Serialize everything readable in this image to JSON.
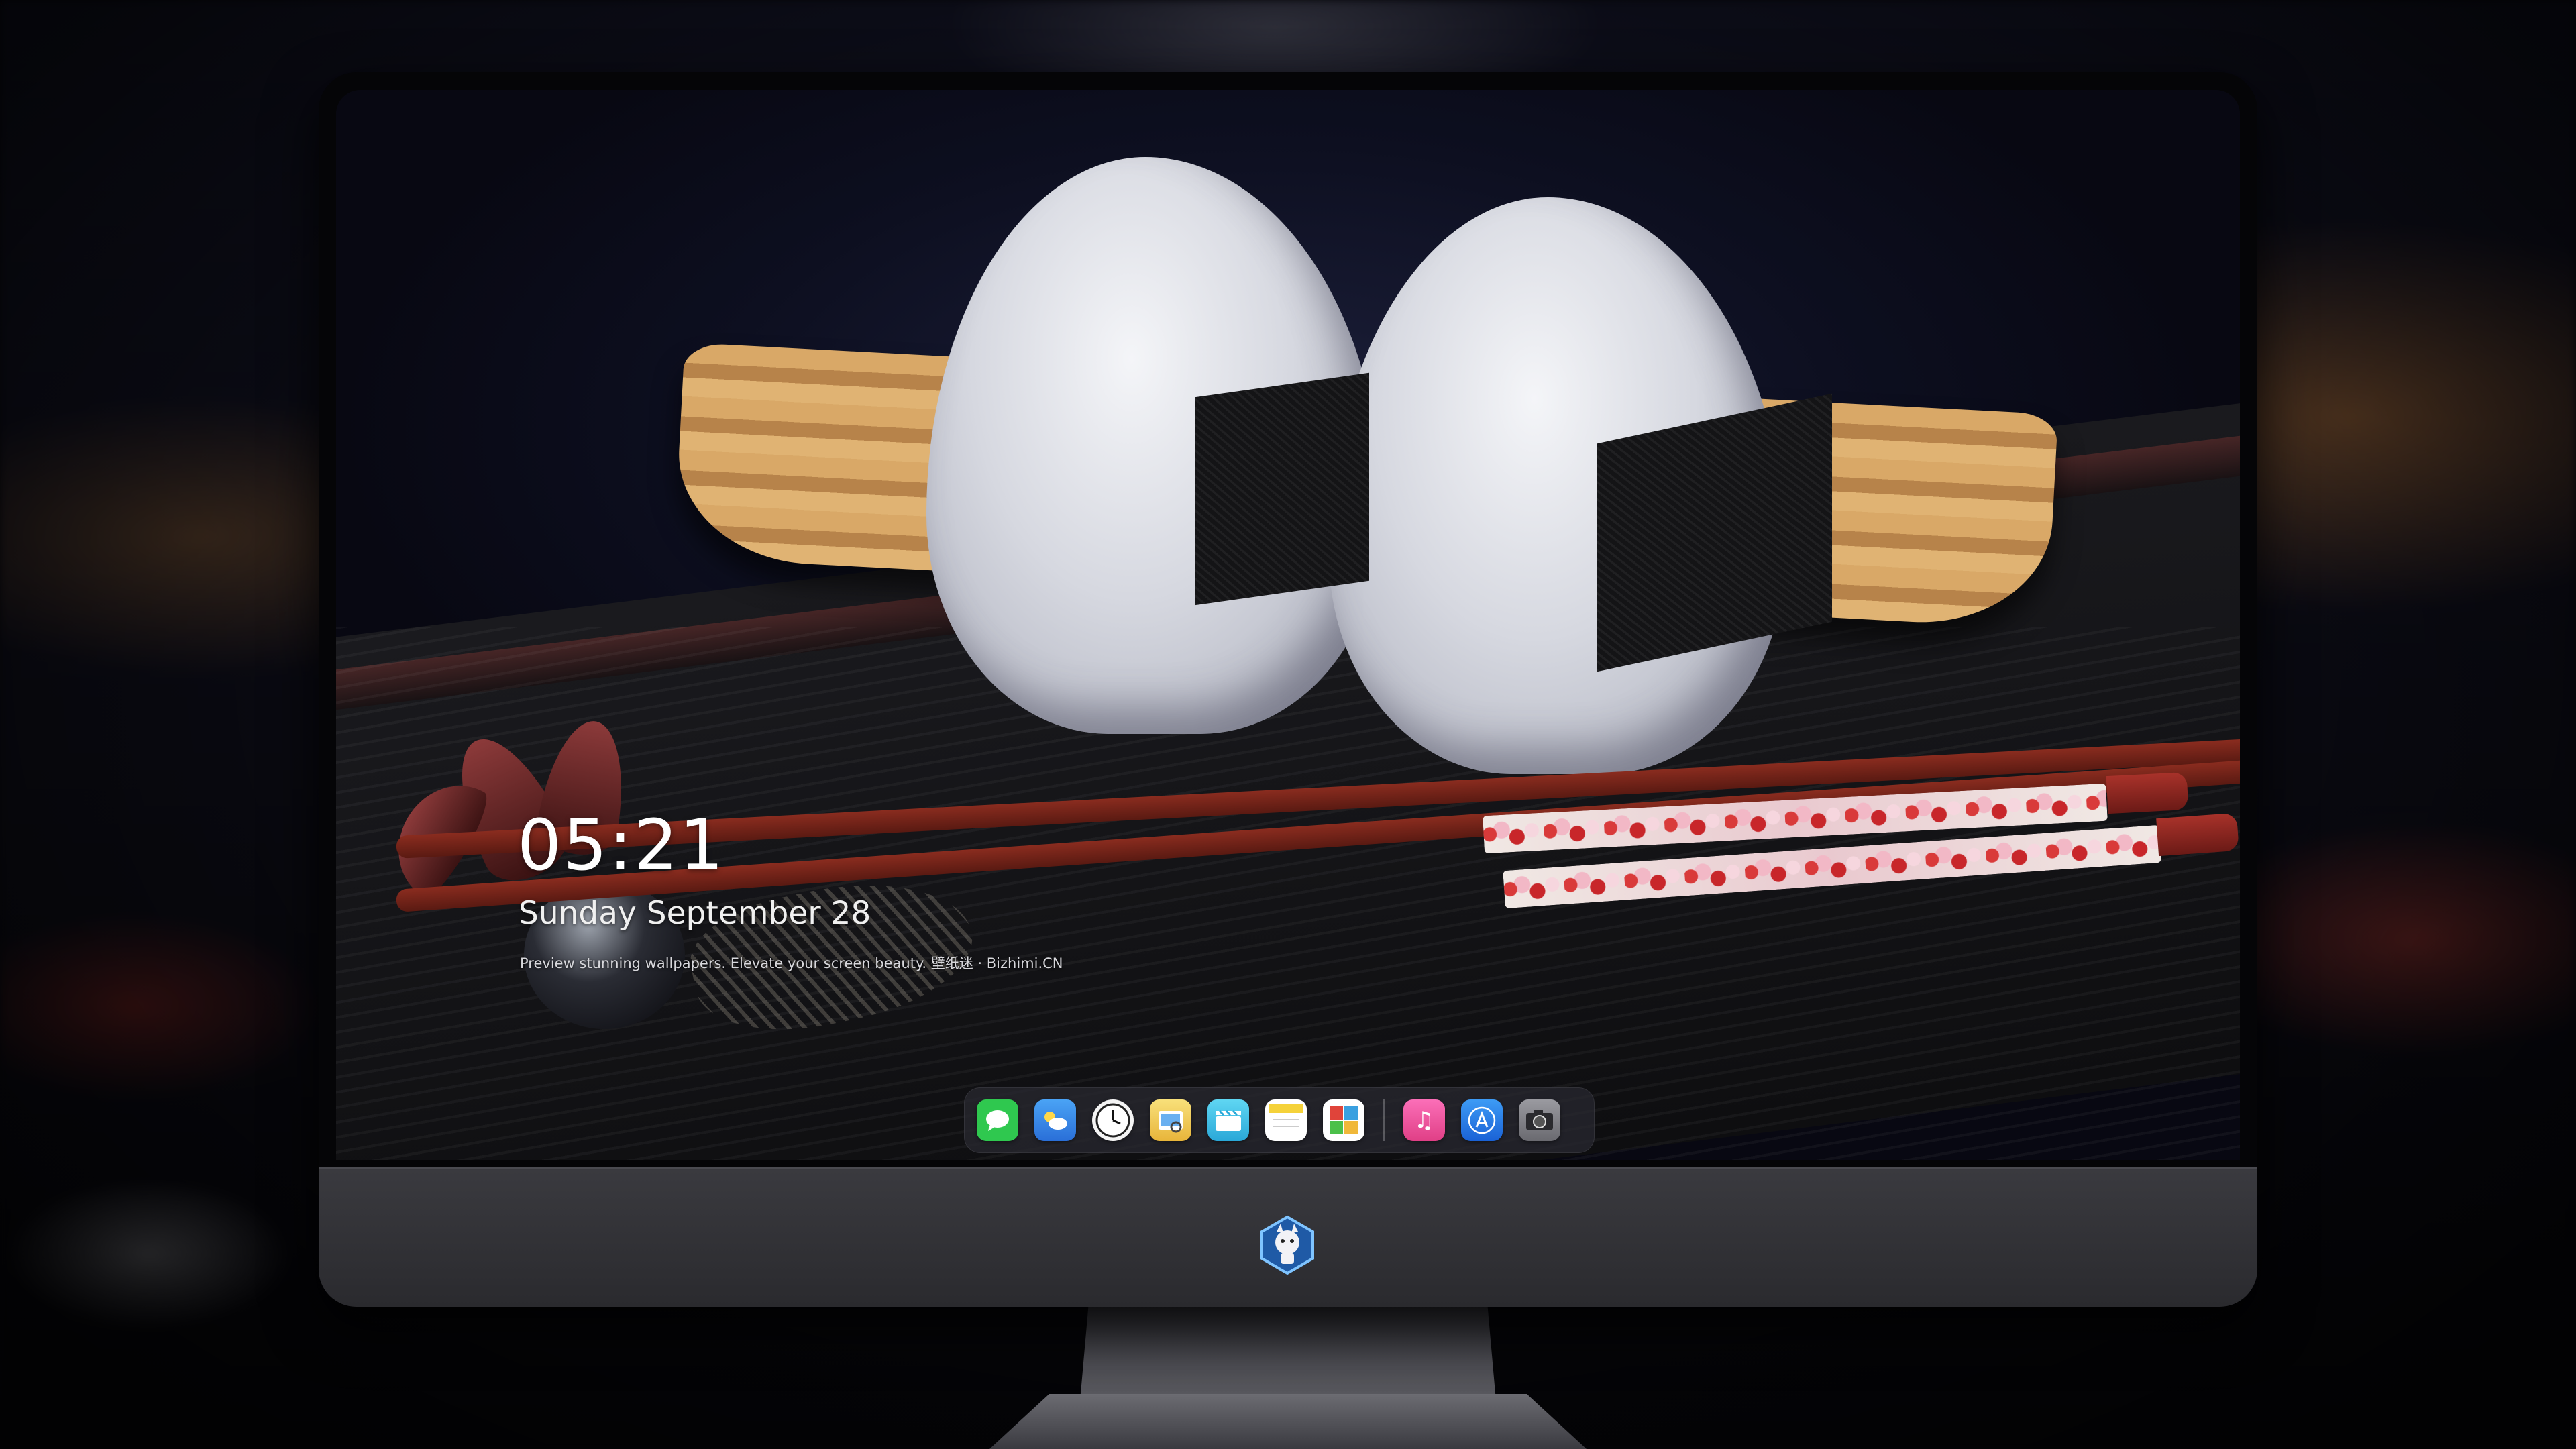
{
  "lock_screen": {
    "time": "05:21",
    "date": "Sunday September  28",
    "caption": "Preview stunning wallpapers. Elevate your screen beauty.  壁纸迷 · Bizhimi.CN"
  },
  "dock": {
    "apps": [
      {
        "name": "messages-icon",
        "color": "#2fc84f"
      },
      {
        "name": "weather-icon",
        "color": "#3a8ef0"
      },
      {
        "name": "clock-icon",
        "color": "#ffffff"
      },
      {
        "name": "preview-icon",
        "color": "#f3c845"
      },
      {
        "name": "clips-icon",
        "color": "#35c5e8"
      },
      {
        "name": "notes-icon",
        "color": "#f5d23a"
      },
      {
        "name": "photo-booth-icon",
        "color": "#e0443a"
      },
      {
        "name": "music-icon",
        "color": "#f45fa8"
      },
      {
        "name": "app-store-icon",
        "color": "#2b7de9"
      },
      {
        "name": "camera-icon",
        "color": "#8a8a90"
      }
    ]
  },
  "colors": {
    "monitor_chin": "#2f2f34",
    "dock_background": "rgba(40,40,48,0.75)"
  }
}
